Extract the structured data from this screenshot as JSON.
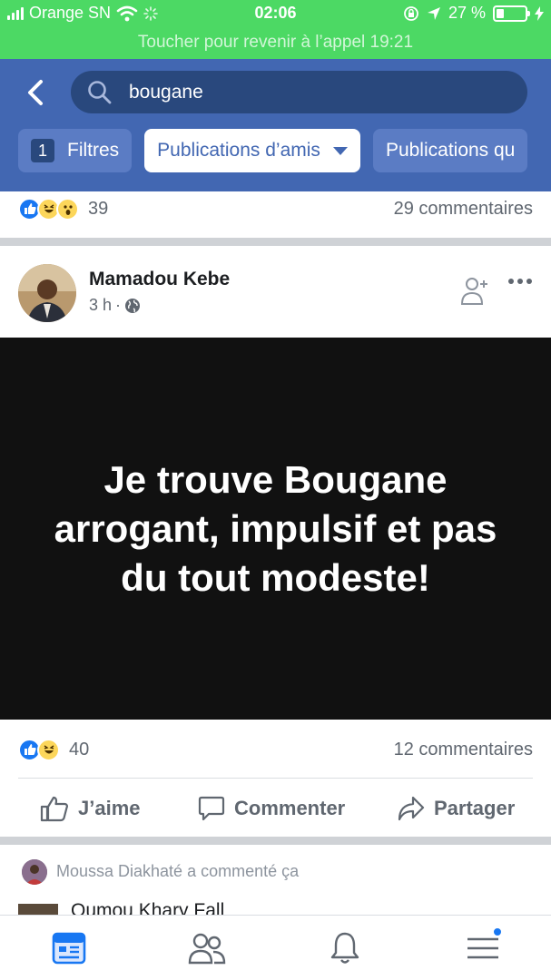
{
  "status_bar": {
    "carrier": "Orange SN",
    "time": "02:06",
    "battery": "27 %",
    "battery_level": 0.27,
    "call_banner": "Toucher pour revenir à l’appel 19:21"
  },
  "search": {
    "query": "bougane"
  },
  "filters": {
    "count": "1",
    "filters_label": "Filtres",
    "friends_posts_label": "Publications d’amis",
    "public_posts_label": "Publications qu"
  },
  "previous_post": {
    "reaction_count": "39",
    "comments": "29 commentaires"
  },
  "post": {
    "author": "Mamadou Kebe",
    "time": "3 h",
    "text": "Je trouve Bougane arrogant, impulsif et pas du tout modeste!",
    "reaction_count": "40",
    "comments": "12 commentaires",
    "like_label": "J’aime",
    "comment_label": "Commenter",
    "share_label": "Partager"
  },
  "comment_preview": {
    "activity": "Moussa Diakhaté a commenté ça",
    "commenter": "Oumou Khary Fall"
  },
  "colors": {
    "status_green": "#4cd964",
    "header_blue": "#4267b2",
    "like_blue": "#1877f2"
  }
}
